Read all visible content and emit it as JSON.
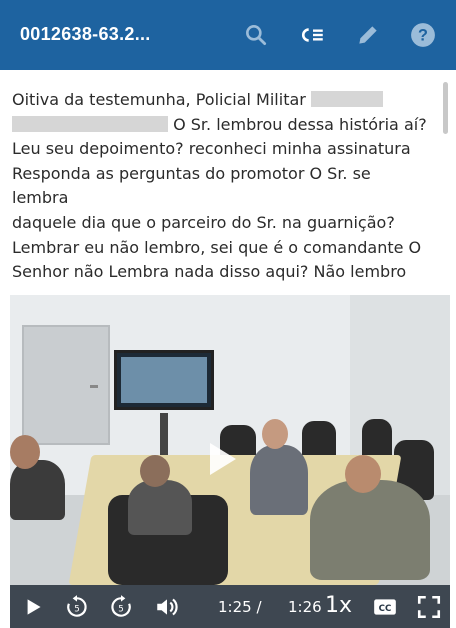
{
  "header": {
    "title": "0012638-63.2...",
    "icons": [
      "search-icon",
      "chapters-icon",
      "edit-icon",
      "help-icon"
    ]
  },
  "transcript": {
    "line1": "Oitiva da testemunha, Policial Militar",
    "line2_tail": "O Sr. lembrou dessa história aí?",
    "line3": "Leu seu depoimento? reconheci minha assinatura",
    "line4": "Responda as perguntas do promotor O Sr. se lembra",
    "line5": "daquele dia que o parceiro do Sr. na guarnição?",
    "line6": "Lembrar eu não lembro, sei que é o comandante O",
    "line7": "Senhor não Lembra nada disso aqui? Não lembro"
  },
  "player": {
    "current_time": "1:25 /",
    "duration": "1:26",
    "speed": "1x",
    "icons": [
      "play-icon",
      "rewind-5-icon",
      "forward-5-icon",
      "volume-icon",
      "captions-icon",
      "fullscreen-icon"
    ]
  },
  "colors": {
    "header_bg": "#1e63a0",
    "header_text": "#ffffff",
    "text": "#2b2b2b",
    "redaction": "#d6d6d6"
  }
}
